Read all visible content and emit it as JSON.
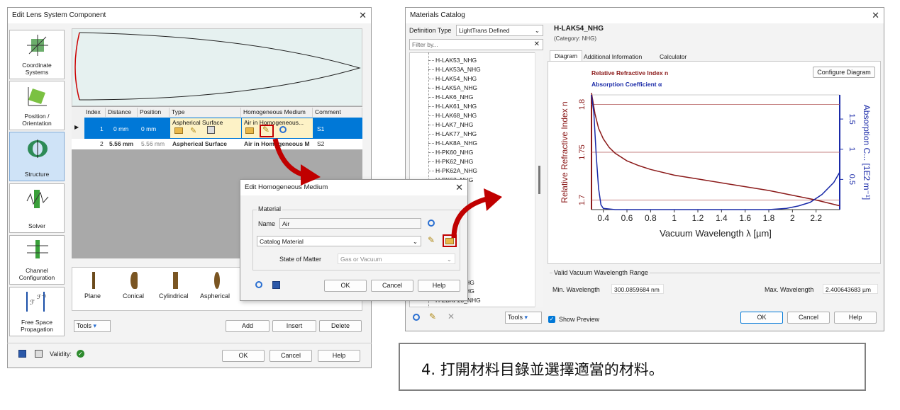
{
  "left_window": {
    "title": "Edit Lens System Component",
    "sidebar": [
      "Coordinate Systems",
      "Position / Orientation",
      "Structure",
      "Solver",
      "Channel Configuration",
      "Free Space Propagation"
    ],
    "table_headers": [
      "Index",
      "Distance",
      "Position",
      "Type",
      "Homogeneous Medium",
      "Comment"
    ],
    "rows": [
      {
        "index": "1",
        "distance": "0 mm",
        "position": "0 mm",
        "type": "Aspherical Surface",
        "medium": "Air in Homogeneous...",
        "comment": "S1"
      },
      {
        "index": "2",
        "distance": "5.56 mm",
        "position": "5.56 mm",
        "type": "Aspherical Surface",
        "medium": "Air in Homogeneous M",
        "comment": "S2"
      }
    ],
    "shapes": [
      "Plane",
      "Conical",
      "Cylindrical",
      "Aspherical"
    ],
    "tools_label": "Tools",
    "add_label": "Add",
    "insert_label": "Insert",
    "delete_label": "Delete",
    "validity_label": "Validity:",
    "ok_label": "OK",
    "cancel_label": "Cancel",
    "help_label": "Help"
  },
  "medium_dialog": {
    "title": "Edit Homogeneous Medium",
    "group_label": "Material",
    "name_label": "Name",
    "name_value": "Air",
    "catalog_value": "Catalog Material",
    "state_label": "State of Matter",
    "state_value": "Gas or Vacuum",
    "ok_label": "OK",
    "cancel_label": "Cancel",
    "help_label": "Help"
  },
  "catalog_window": {
    "title": "Materials Catalog",
    "definition_label": "Definition Type",
    "definition_value": "LightTrans Defined",
    "filter_placeholder": "Filter by...",
    "tree_items": [
      "H-LAK53_NHG",
      "H-LAK53A_NHG",
      "H-LAK54_NHG",
      "H-LAK5A_NHG",
      "H-LAK6_NHG",
      "H-LAK61_NHG",
      "H-LAK68_NHG",
      "H-LAK7_NHG",
      "H-LAK77_NHG",
      "H-LAK8A_NHG",
      "H-PK60_NHG",
      "H-PK62_NHG",
      "H-PK62A_NHG",
      "H-PK63_NHG"
    ],
    "tree_bottom": [
      "NHG",
      "NHG",
      "H-ZBAF20_NHG"
    ],
    "material_name": "H-LAK54_NHG",
    "category": "(Category: NHG)",
    "tabs": [
      "Diagram",
      "Additional Information",
      "Calculator"
    ],
    "configure_label": "Configure Diagram",
    "legend_n": "Relative Refractive Index n",
    "legend_a": "Absorption Coefficient α",
    "range_group": "Valid Vacuum Wavelength Range",
    "min_label": "Min. Wavelength",
    "min_value": "300.0859684 nm",
    "max_label": "Max. Wavelength",
    "max_value": "2.400643683 µm",
    "tools_label": "Tools",
    "show_preview_label": "Show Preview",
    "ok_label": "OK",
    "cancel_label": "Cancel",
    "help_label": "Help"
  },
  "caption": "4. 打開材料目錄並選擇適當的材料。",
  "chart_data": {
    "type": "line",
    "xlabel": "Vacuum Wavelength λ [µm]",
    "ylabel": "Relative Refractive Index n",
    "y2label": "Absorption C... [1E2 m⁻¹]",
    "xticks": [
      "0.4",
      "0.6",
      "0.8",
      "1",
      "1.2",
      "1.4",
      "1.6",
      "1.8",
      "2",
      "2.2"
    ],
    "yticks": [
      "1.7",
      "1.75",
      "1.8"
    ],
    "y2ticks": [
      "0.5",
      "1",
      "1.5"
    ],
    "xlim": [
      0.3,
      2.4
    ],
    "ylim": [
      1.69,
      1.81
    ],
    "y2lim": [
      0,
      1.9
    ],
    "series": [
      {
        "name": "Relative Refractive Index n",
        "color": "#8b1a1a",
        "x": [
          0.3,
          0.33,
          0.36,
          0.4,
          0.45,
          0.5,
          0.6,
          0.7,
          0.8,
          1.0,
          1.2,
          1.4,
          1.6,
          1.8,
          2.0,
          2.2,
          2.4
        ],
        "y": [
          1.812,
          1.79,
          1.775,
          1.764,
          1.755,
          1.749,
          1.741,
          1.736,
          1.732,
          1.726,
          1.722,
          1.718,
          1.714,
          1.71,
          1.705,
          1.7,
          1.694
        ]
      },
      {
        "name": "Absorption Coefficient α",
        "color": "#1a2aa8",
        "x": [
          0.3,
          0.32,
          0.34,
          0.36,
          0.38,
          0.4,
          0.5,
          1.0,
          1.5,
          1.8,
          1.95,
          2.05,
          2.15,
          2.25,
          2.35,
          2.4
        ],
        "y": [
          1.9,
          1.6,
          0.9,
          0.35,
          0.08,
          0.02,
          0.0,
          0.0,
          0.0,
          0.0,
          0.02,
          0.06,
          0.12,
          0.25,
          0.45,
          0.62
        ]
      }
    ]
  },
  "colors": {
    "accent_blue": "#0078d7",
    "highlight_red": "#c00000"
  }
}
